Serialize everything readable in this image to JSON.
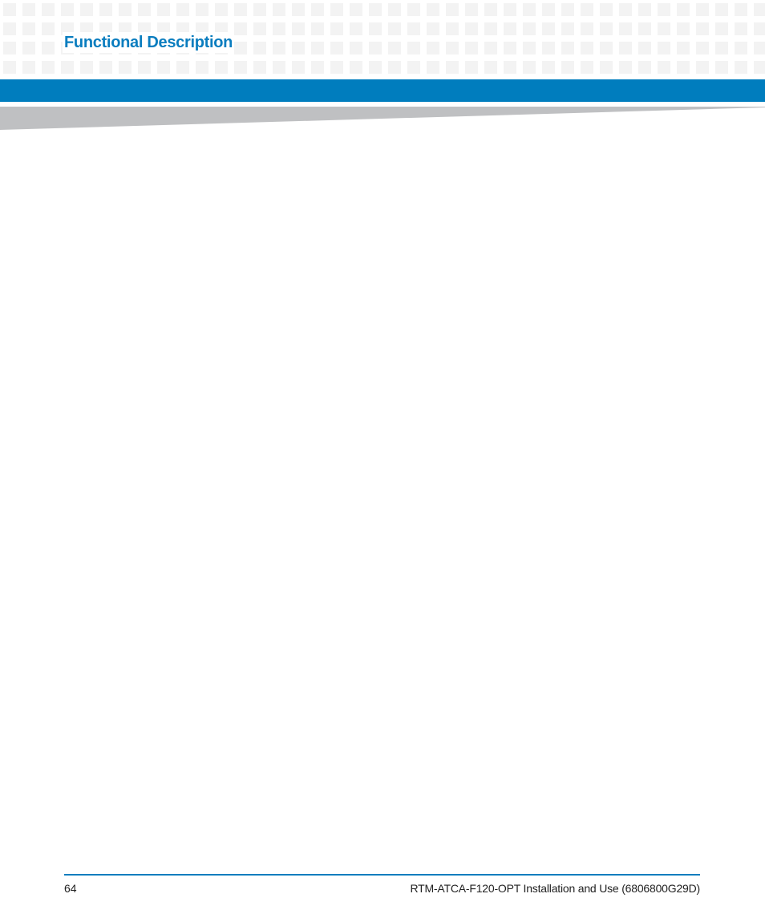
{
  "header": {
    "section_title": "Functional Description"
  },
  "footer": {
    "page_number": "64",
    "document_title": "RTM-ATCA-F120-OPT Installation and Use (6806800G29D)"
  },
  "colors": {
    "brand_blue": "#007dbe",
    "title_blue": "#0a7dbf",
    "pattern_gray": "#f3f3f3",
    "wedge_gray": "#bfc0c2"
  }
}
